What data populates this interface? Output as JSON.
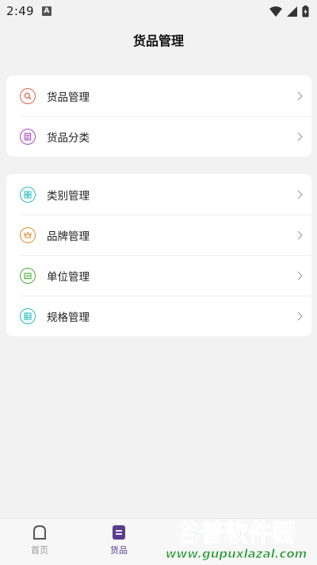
{
  "status": {
    "time": "2:49",
    "notif_glyph": "A"
  },
  "header": {
    "title": "货品管理"
  },
  "group1": [
    {
      "label": "货品管理",
      "icon": "search-icon",
      "color": "#e0614f"
    },
    {
      "label": "货品分类",
      "icon": "list-icon",
      "color": "#b045c8"
    }
  ],
  "group2": [
    {
      "label": "类别管理",
      "icon": "grid-icon",
      "color": "#2bbcc0"
    },
    {
      "label": "品牌管理",
      "icon": "crown-icon",
      "color": "#ef8a2b"
    },
    {
      "label": "单位管理",
      "icon": "unit-icon",
      "color": "#4caf38"
    },
    {
      "label": "规格管理",
      "icon": "table-icon",
      "color": "#2bbcc0"
    }
  ],
  "tabs": [
    {
      "label": "首页"
    },
    {
      "label": "货品"
    }
  ],
  "colors": {
    "accent": "#5b3d8f",
    "background": "#f2f2f2"
  },
  "watermark": {
    "line1": "谷普软件园",
    "line2": "www.gupuxlazal.com"
  }
}
